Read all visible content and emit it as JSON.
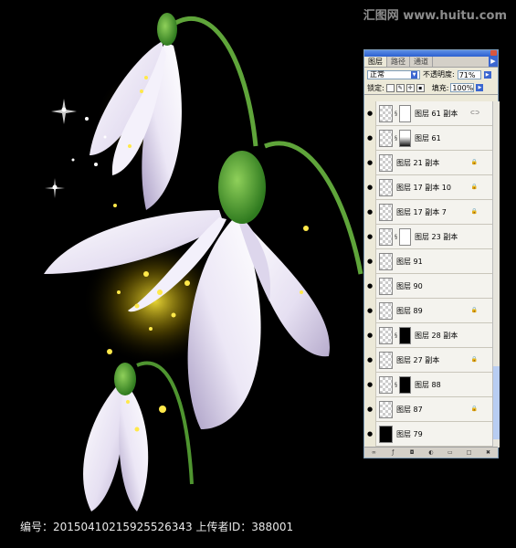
{
  "watermark_top": "汇图网 www.huitu.com",
  "footer": "编号：20150410215925526343 上传者ID：388001",
  "panel": {
    "tabs": [
      "图层",
      "路径",
      "通道"
    ],
    "blend_mode": "正常",
    "opacity_label": "不透明度:",
    "opacity_value": "71%",
    "lock_label": "锁定:",
    "fill_label": "填充:",
    "fill_value": "100%",
    "layers": [
      {
        "name": "图层 61 副本",
        "thumb": "checker",
        "mask": "white",
        "chain": true,
        "badge": "fx-link"
      },
      {
        "name": "图层 61",
        "thumb": "checker",
        "mask": "grad",
        "chain": true,
        "badge": ""
      },
      {
        "name": "图层 21 副本",
        "thumb": "checker",
        "mask": "",
        "chain": false,
        "badge": "lock"
      },
      {
        "name": "图层 17 副本 10",
        "thumb": "checker",
        "mask": "",
        "chain": false,
        "badge": "lock"
      },
      {
        "name": "图层 17 副本 7",
        "thumb": "checker",
        "mask": "",
        "chain": false,
        "badge": "lock"
      },
      {
        "name": "图层 23 副本",
        "thumb": "checker",
        "mask": "white",
        "chain": true,
        "badge": ""
      },
      {
        "name": "图层 91",
        "thumb": "checker",
        "mask": "",
        "chain": false,
        "badge": ""
      },
      {
        "name": "图层 90",
        "thumb": "checker",
        "mask": "",
        "chain": false,
        "badge": ""
      },
      {
        "name": "图层 89",
        "thumb": "checker",
        "mask": "",
        "chain": false,
        "badge": "lock"
      },
      {
        "name": "图层 28 副本",
        "thumb": "checker",
        "mask": "black",
        "chain": true,
        "badge": ""
      },
      {
        "name": "图层 27 副本",
        "thumb": "checker",
        "mask": "",
        "chain": false,
        "badge": "lock"
      },
      {
        "name": "图层 88",
        "thumb": "checker",
        "mask": "black",
        "chain": true,
        "badge": ""
      },
      {
        "name": "图层 87",
        "thumb": "checker",
        "mask": "",
        "chain": false,
        "badge": "lock"
      },
      {
        "name": "图层 79",
        "thumb": "black",
        "mask": "",
        "chain": false,
        "badge": ""
      }
    ]
  }
}
